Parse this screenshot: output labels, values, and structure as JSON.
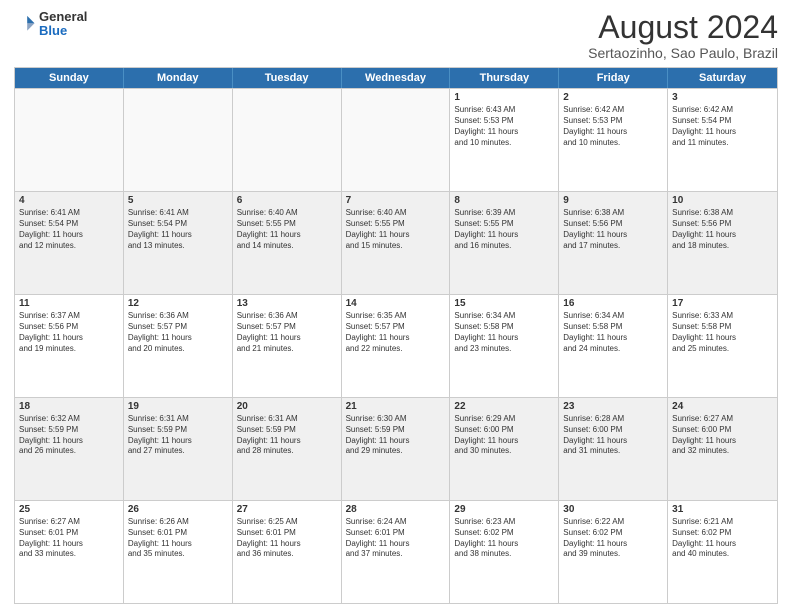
{
  "logo": {
    "general": "General",
    "blue": "Blue"
  },
  "title": "August 2024",
  "subtitle": "Sertaozinho, Sao Paulo, Brazil",
  "days": [
    "Sunday",
    "Monday",
    "Tuesday",
    "Wednesday",
    "Thursday",
    "Friday",
    "Saturday"
  ],
  "weeks": [
    [
      {
        "day": "",
        "info": ""
      },
      {
        "day": "",
        "info": ""
      },
      {
        "day": "",
        "info": ""
      },
      {
        "day": "",
        "info": ""
      },
      {
        "day": "1",
        "info": "Sunrise: 6:43 AM\nSunset: 5:53 PM\nDaylight: 11 hours\nand 10 minutes."
      },
      {
        "day": "2",
        "info": "Sunrise: 6:42 AM\nSunset: 5:53 PM\nDaylight: 11 hours\nand 10 minutes."
      },
      {
        "day": "3",
        "info": "Sunrise: 6:42 AM\nSunset: 5:54 PM\nDaylight: 11 hours\nand 11 minutes."
      }
    ],
    [
      {
        "day": "4",
        "info": "Sunrise: 6:41 AM\nSunset: 5:54 PM\nDaylight: 11 hours\nand 12 minutes."
      },
      {
        "day": "5",
        "info": "Sunrise: 6:41 AM\nSunset: 5:54 PM\nDaylight: 11 hours\nand 13 minutes."
      },
      {
        "day": "6",
        "info": "Sunrise: 6:40 AM\nSunset: 5:55 PM\nDaylight: 11 hours\nand 14 minutes."
      },
      {
        "day": "7",
        "info": "Sunrise: 6:40 AM\nSunset: 5:55 PM\nDaylight: 11 hours\nand 15 minutes."
      },
      {
        "day": "8",
        "info": "Sunrise: 6:39 AM\nSunset: 5:55 PM\nDaylight: 11 hours\nand 16 minutes."
      },
      {
        "day": "9",
        "info": "Sunrise: 6:38 AM\nSunset: 5:56 PM\nDaylight: 11 hours\nand 17 minutes."
      },
      {
        "day": "10",
        "info": "Sunrise: 6:38 AM\nSunset: 5:56 PM\nDaylight: 11 hours\nand 18 minutes."
      }
    ],
    [
      {
        "day": "11",
        "info": "Sunrise: 6:37 AM\nSunset: 5:56 PM\nDaylight: 11 hours\nand 19 minutes."
      },
      {
        "day": "12",
        "info": "Sunrise: 6:36 AM\nSunset: 5:57 PM\nDaylight: 11 hours\nand 20 minutes."
      },
      {
        "day": "13",
        "info": "Sunrise: 6:36 AM\nSunset: 5:57 PM\nDaylight: 11 hours\nand 21 minutes."
      },
      {
        "day": "14",
        "info": "Sunrise: 6:35 AM\nSunset: 5:57 PM\nDaylight: 11 hours\nand 22 minutes."
      },
      {
        "day": "15",
        "info": "Sunrise: 6:34 AM\nSunset: 5:58 PM\nDaylight: 11 hours\nand 23 minutes."
      },
      {
        "day": "16",
        "info": "Sunrise: 6:34 AM\nSunset: 5:58 PM\nDaylight: 11 hours\nand 24 minutes."
      },
      {
        "day": "17",
        "info": "Sunrise: 6:33 AM\nSunset: 5:58 PM\nDaylight: 11 hours\nand 25 minutes."
      }
    ],
    [
      {
        "day": "18",
        "info": "Sunrise: 6:32 AM\nSunset: 5:59 PM\nDaylight: 11 hours\nand 26 minutes."
      },
      {
        "day": "19",
        "info": "Sunrise: 6:31 AM\nSunset: 5:59 PM\nDaylight: 11 hours\nand 27 minutes."
      },
      {
        "day": "20",
        "info": "Sunrise: 6:31 AM\nSunset: 5:59 PM\nDaylight: 11 hours\nand 28 minutes."
      },
      {
        "day": "21",
        "info": "Sunrise: 6:30 AM\nSunset: 5:59 PM\nDaylight: 11 hours\nand 29 minutes."
      },
      {
        "day": "22",
        "info": "Sunrise: 6:29 AM\nSunset: 6:00 PM\nDaylight: 11 hours\nand 30 minutes."
      },
      {
        "day": "23",
        "info": "Sunrise: 6:28 AM\nSunset: 6:00 PM\nDaylight: 11 hours\nand 31 minutes."
      },
      {
        "day": "24",
        "info": "Sunrise: 6:27 AM\nSunset: 6:00 PM\nDaylight: 11 hours\nand 32 minutes."
      }
    ],
    [
      {
        "day": "25",
        "info": "Sunrise: 6:27 AM\nSunset: 6:01 PM\nDaylight: 11 hours\nand 33 minutes."
      },
      {
        "day": "26",
        "info": "Sunrise: 6:26 AM\nSunset: 6:01 PM\nDaylight: 11 hours\nand 35 minutes."
      },
      {
        "day": "27",
        "info": "Sunrise: 6:25 AM\nSunset: 6:01 PM\nDaylight: 11 hours\nand 36 minutes."
      },
      {
        "day": "28",
        "info": "Sunrise: 6:24 AM\nSunset: 6:01 PM\nDaylight: 11 hours\nand 37 minutes."
      },
      {
        "day": "29",
        "info": "Sunrise: 6:23 AM\nSunset: 6:02 PM\nDaylight: 11 hours\nand 38 minutes."
      },
      {
        "day": "30",
        "info": "Sunrise: 6:22 AM\nSunset: 6:02 PM\nDaylight: 11 hours\nand 39 minutes."
      },
      {
        "day": "31",
        "info": "Sunrise: 6:21 AM\nSunset: 6:02 PM\nDaylight: 11 hours\nand 40 minutes."
      }
    ]
  ]
}
